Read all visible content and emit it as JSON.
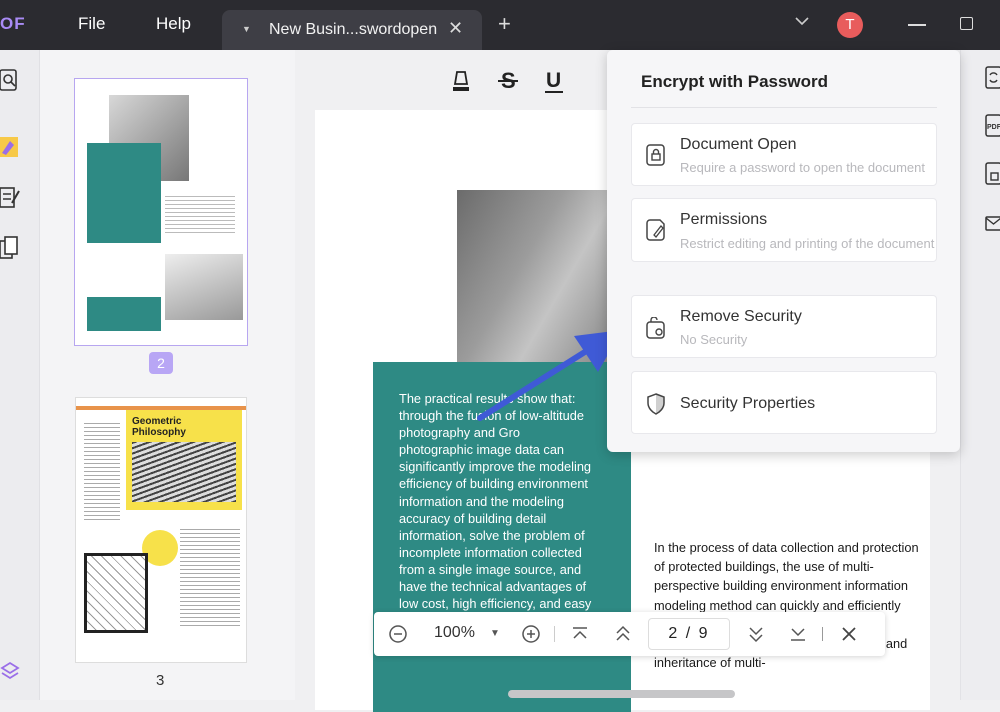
{
  "titlebar": {
    "logo": "OF",
    "menu": [
      "File",
      "Help"
    ],
    "tab_title": "New Busin...swordopen",
    "tab_close": "✕",
    "new_tab": "+",
    "avatar_letter": "T",
    "avatar_color": "#e85c5c"
  },
  "thumbnails": {
    "page2_label": "2",
    "page3_label": "3",
    "page3_heading": "Geometric Philosophy"
  },
  "document": {
    "teal_paragraph": "The practical results show that: through the fusion of low-altitude photography and Gro photographic image data can significantly improve the modeling efficiency of building environment information and the modeling accuracy of building detail information, solve the problem of incomplete information collected from a single image source, and have the technical advantages of low cost, high efficiency, and easy operation.",
    "right_paragraph": "In the process of data collection and protection of protected buildings, the use of multi-perspective building environment information modeling method can quickly and efficiently save and record its three-dimensional information, and realize the preservation and inheritance of multi-"
  },
  "navbar": {
    "zoom": "100%",
    "page_current": "2",
    "page_total": "9",
    "page_separator": "/"
  },
  "popover": {
    "title": "Encrypt with Password",
    "items": [
      {
        "title": "Document Open",
        "subtitle": "Require a password to open the document"
      },
      {
        "title": "Permissions",
        "subtitle": "Restrict editing and printing of the document"
      },
      {
        "title": "Remove Security",
        "subtitle": "No Security"
      },
      {
        "title": "Security Properties",
        "subtitle": ""
      }
    ]
  },
  "colors": {
    "accent": "#b8a6f5",
    "teal": "#2e8a84",
    "arrow": "#3f5ad6"
  }
}
